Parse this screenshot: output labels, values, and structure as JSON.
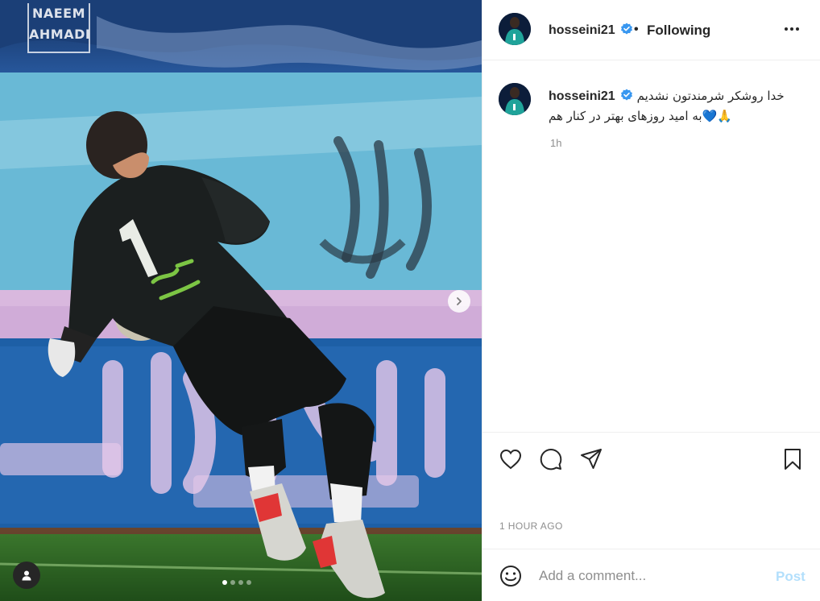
{
  "media": {
    "watermark": {
      "line1": "NAEEM",
      "line2": "AHMADI"
    },
    "player_number": "1",
    "carousel": {
      "total": 4,
      "active_index": 0
    }
  },
  "post": {
    "username": "hosseini21",
    "follow_status": "Following",
    "separator": "•",
    "caption_line1": "خدا روشکر شرمندتون نشدیم",
    "caption_line2": "🙏💙به امید روزهای بهتر در کنار هم",
    "time_relative": "1h",
    "time_full": "1 HOUR AGO"
  },
  "comment_box": {
    "placeholder": "Add a comment...",
    "post_label": "Post"
  },
  "colors": {
    "verified": "#3897f0",
    "post_button_disabled": "#b2dffc",
    "muted_text": "#8e8e8e"
  },
  "icons": [
    "verified-badge-icon",
    "more-options-icon",
    "heart-icon",
    "comment-icon",
    "share-icon",
    "bookmark-icon",
    "emoji-icon",
    "chevron-right-icon",
    "user-tag-icon"
  ]
}
